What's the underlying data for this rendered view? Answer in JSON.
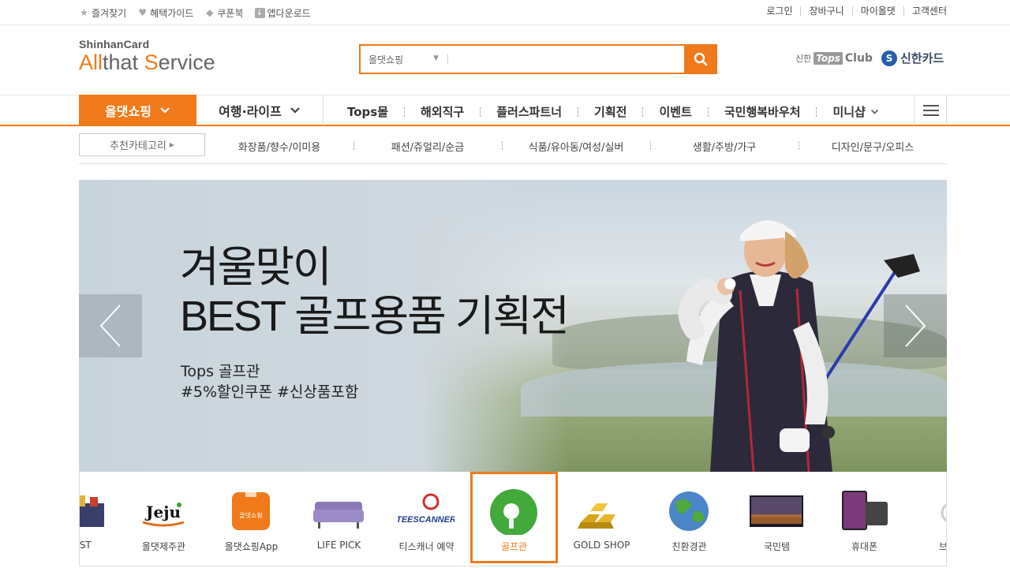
{
  "topbar": {
    "left": [
      {
        "icon": "star-icon",
        "label": "즐겨찾기"
      },
      {
        "icon": "heart-icon",
        "label": "혜택가이드"
      },
      {
        "icon": "tag-icon",
        "label": "쿠폰북"
      },
      {
        "icon": "download-icon",
        "label": "앱다운로드"
      }
    ],
    "right": [
      "로그인",
      "장바구니",
      "마이올댓",
      "고객센터"
    ]
  },
  "header": {
    "logo_small": "ShinhanCard",
    "logo_big_1": "All",
    "logo_big_2": "that ",
    "logo_big_3": "S",
    "logo_big_4": "ervice",
    "search_select": "올댓쇼핑",
    "search_value": "",
    "tops_prefix": "신한",
    "tops_badge": "Tops",
    "tops_club": "Club",
    "card_brand": "신한카드"
  },
  "nav": {
    "primary": "올댓쇼핑",
    "secondary": "여행·라이프",
    "menu": [
      "Tops몰",
      "해외직구",
      "플러스파트너",
      "기획전",
      "이벤트",
      "국민행복바우처",
      "미니샵"
    ]
  },
  "catbar": {
    "recommend": "추천카테고리",
    "categories": [
      "화장품/향수/이미용",
      "패션/쥬얼리/순금",
      "식품/유아동/여성/실버",
      "생활/주방/가구",
      "디자인/문구/오피스"
    ]
  },
  "banner": {
    "title_line1": "겨울맞이",
    "title_line2": "BEST 골프용품 기획전",
    "sub_line1": "Tops 골프관",
    "sub_line2": "#5%할인쿠폰 #신상품포함"
  },
  "shortcuts": [
    {
      "label": "BEST"
    },
    {
      "label": "올댓제주관",
      "img_text": "Jeju"
    },
    {
      "label": "올댓쇼핑App",
      "img_text": "올댓쇼핑"
    },
    {
      "label": "LIFE PICK"
    },
    {
      "label": "티스캐너 예약",
      "img_text": "TEESCANNER"
    },
    {
      "label": "골프관",
      "active": true
    },
    {
      "label": "GOLD SHOP"
    },
    {
      "label": "친환경관"
    },
    {
      "label": "국민템"
    },
    {
      "label": "휴대폰"
    },
    {
      "label": "브랜드"
    }
  ],
  "colors": {
    "accent": "#f07a1a"
  }
}
